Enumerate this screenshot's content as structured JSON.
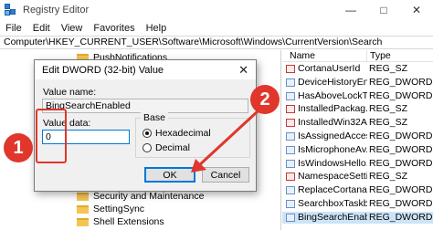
{
  "window": {
    "title": "Registry Editor",
    "minimize": "—",
    "maximize": "□",
    "close": "✕"
  },
  "menu": [
    "File",
    "Edit",
    "View",
    "Favorites",
    "Help"
  ],
  "address": "Computer\\HKEY_CURRENT_USER\\Software\\Microsoft\\Windows\\CurrentVersion\\Search",
  "tree": {
    "top_item": "PushNotifications",
    "bottom_items": [
      "Security and Maintenance",
      "SettingSync",
      "Shell Extensions"
    ]
  },
  "list": {
    "header_name": "Name",
    "header_type": "Type",
    "rows": [
      {
        "name": "CortanaUserId",
        "type": "REG_SZ",
        "icon": "string-value-icon"
      },
      {
        "name": "DeviceHistoryEn...",
        "type": "REG_DWORD",
        "icon": "dword-value-icon"
      },
      {
        "name": "HasAboveLockT...",
        "type": "REG_DWORD",
        "icon": "dword-value-icon"
      },
      {
        "name": "InstalledPackag...",
        "type": "REG_SZ",
        "icon": "string-value-icon"
      },
      {
        "name": "InstalledWin32A...",
        "type": "REG_SZ",
        "icon": "string-value-icon"
      },
      {
        "name": "IsAssignedAccess",
        "type": "REG_DWORD",
        "icon": "dword-value-icon"
      },
      {
        "name": "IsMicrophoneAv...",
        "type": "REG_DWORD",
        "icon": "dword-value-icon"
      },
      {
        "name": "IsWindowsHello...",
        "type": "REG_DWORD",
        "icon": "dword-value-icon"
      },
      {
        "name": "NamespaceSetti...",
        "type": "REG_SZ",
        "icon": "string-value-icon"
      },
      {
        "name": "ReplaceCortana...",
        "type": "REG_DWORD",
        "icon": "dword-value-icon"
      },
      {
        "name": "SearchboxTaskb...",
        "type": "REG_DWORD",
        "icon": "dword-value-icon"
      },
      {
        "name": "BingSearchEnab...",
        "type": "REG_DWORD",
        "icon": "dword-value-icon",
        "selected": true
      }
    ]
  },
  "dialog": {
    "title": "Edit DWORD (32-bit) Value",
    "close": "✕",
    "value_name_label": "Value name:",
    "value_name": "BingSearchEnabled",
    "value_data_label": "Value data:",
    "value_data": "0",
    "base_label": "Base",
    "base_options": [
      "Hexadecimal",
      "Decimal"
    ],
    "base_selected": "Hexadecimal",
    "ok": "OK",
    "cancel": "Cancel"
  },
  "callouts": {
    "step1": "1",
    "step2": "2",
    "color": "#e0362c"
  }
}
